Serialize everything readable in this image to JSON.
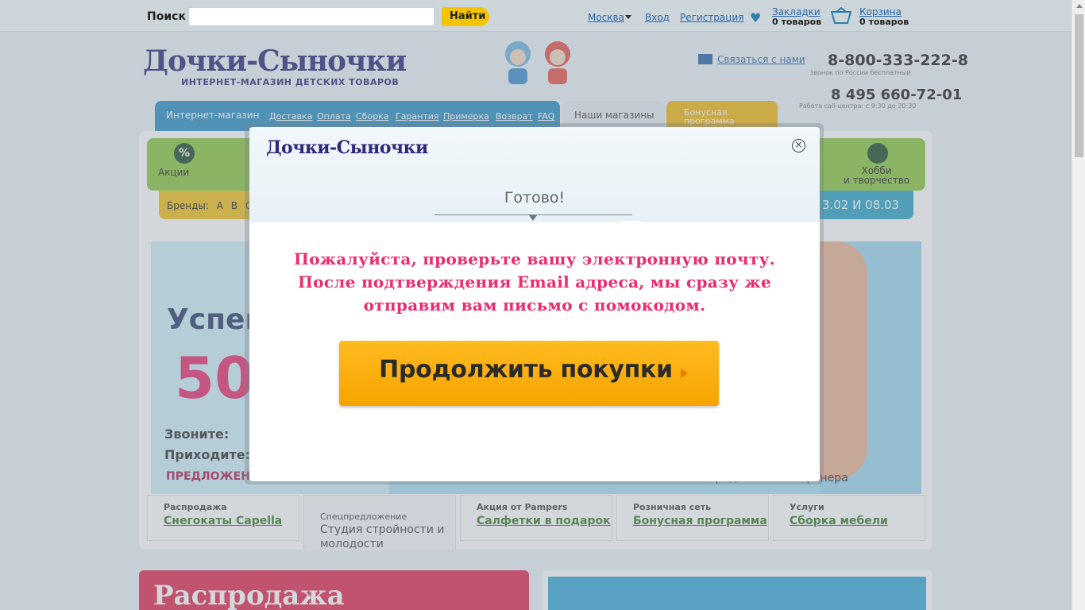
{
  "topbar": {
    "search_label": "Поиск",
    "search_placeholder": "",
    "find_button": "Найти",
    "city": "Москва",
    "login": "Вход",
    "register": "Регистрация",
    "bookmarks_label": "Закладки",
    "bookmarks_count": "0 товаров",
    "cart_label": "Корзина",
    "cart_count": "0 товаров"
  },
  "header": {
    "logo": "Дочки-Сыночки",
    "tagline": "ИНТЕРНЕТ-МАГАЗИН ДЕТСКИХ ТОВАРОВ",
    "contact_link": "Связаться с нами",
    "phone1": "8-800-333-222-8",
    "phone1_note": "звонок по России бесплатный",
    "phone2": "8 495 660-72-01",
    "phone2_note": "Работа call-центра: с 9:30 до 20:30"
  },
  "nav": {
    "shop_tab": "Интернет-магазин",
    "links": [
      "Доставка",
      "Оплата",
      "Сборка",
      "Гарантия",
      "Примерка",
      "Возврат",
      "FAQ"
    ],
    "stores_tab": "Наши магазины",
    "bonus_tab": "Бонусная программа"
  },
  "categories": {
    "first": "Акции",
    "last_line1": "Хобби",
    "last_line2": "и творчество"
  },
  "brands": {
    "label": "Бренды:",
    "letters": [
      "A",
      "B",
      "C"
    ],
    "dates": "3.02 И 08.03"
  },
  "banner": {
    "line1": "Успей",
    "big_number": "50",
    "call": "Звоните:",
    "come": "Приходите:",
    "offer": "ПРЕДЛОЖЕНИЯ",
    "partner": "Предложение партнера"
  },
  "promos": [
    {
      "kind": "Распродажа",
      "value": "Снегокаты Capella"
    },
    {
      "kind": "Спецпредложение",
      "value": "Студия стройности и молодости"
    },
    {
      "kind": "Акция от Pampers",
      "value": "Салфетки в подарок"
    },
    {
      "kind": "Розничная сеть",
      "value": "Бонусная программа"
    },
    {
      "kind": "Услуги",
      "value": "Сборка мебели"
    }
  ],
  "bottom": {
    "sale": "Распродажа"
  },
  "modal": {
    "logo": "Дочки-Сыночки",
    "close": "×",
    "status": "Готово!",
    "message_line1": "Пожалуйста, проверьте вашу электронную почту.",
    "message_line2": "После подтверждения Email адреса, мы сразу же",
    "message_line3": "отправим вам письмо с помокодом.",
    "continue_button": "Продолжить покупки"
  },
  "colors": {
    "brand_navy": "#2c2a7a",
    "accent_pink": "#ec2a6e",
    "button_orange": "#f7a400",
    "link_blue": "#2b66a9"
  }
}
